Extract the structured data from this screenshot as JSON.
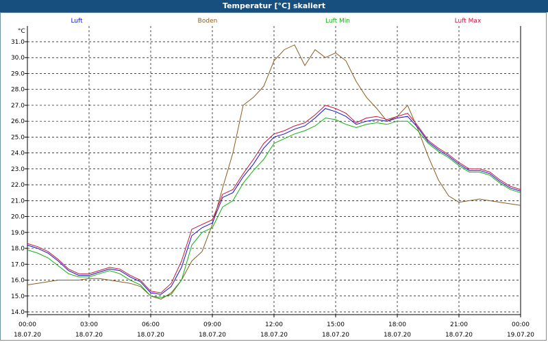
{
  "title": "Temperatur [°C] skaliert",
  "chart_data": {
    "type": "line",
    "unit": "°C",
    "ylim": [
      14.0,
      31.0
    ],
    "yticks": [
      "14.0",
      "15.0",
      "16.0",
      "17.0",
      "18.0",
      "19.0",
      "20.0",
      "21.0",
      "22.0",
      "23.0",
      "24.0",
      "25.0",
      "26.0",
      "27.0",
      "28.0",
      "29.0",
      "30.0",
      "31.0"
    ],
    "xlim_hours": [
      0,
      24
    ],
    "xticks": [
      {
        "time": "00:00",
        "date": "18.07.20"
      },
      {
        "time": "03:00",
        "date": "18.07.20"
      },
      {
        "time": "06:00",
        "date": "18.07.20"
      },
      {
        "time": "09:00",
        "date": "18.07.20"
      },
      {
        "time": "12:00",
        "date": "18.07.20"
      },
      {
        "time": "15:00",
        "date": "18.07.20"
      },
      {
        "time": "18:00",
        "date": "18.07.20"
      },
      {
        "time": "21:00",
        "date": "18.07.20"
      },
      {
        "time": "00:00",
        "date": "19.07.20"
      }
    ],
    "grid": true,
    "legend_position": "top",
    "x_hours": [
      0,
      0.5,
      1,
      1.5,
      2,
      2.5,
      3,
      3.5,
      4,
      4.5,
      5,
      5.5,
      6,
      6.5,
      7,
      7.5,
      8,
      8.5,
      9,
      9.5,
      10,
      10.5,
      11,
      11.5,
      12,
      12.5,
      13,
      13.5,
      14,
      14.5,
      15,
      15.5,
      16,
      16.5,
      17,
      17.5,
      18,
      18.5,
      19,
      19.5,
      20,
      20.5,
      21,
      21.5,
      22,
      22.5,
      23,
      23.5,
      24
    ],
    "series": [
      {
        "name": "Luft",
        "color": "#1010c8",
        "values": [
          18.2,
          18.0,
          17.7,
          17.2,
          16.6,
          16.3,
          16.3,
          16.5,
          16.7,
          16.6,
          16.2,
          15.9,
          15.2,
          15.1,
          15.6,
          16.8,
          18.8,
          19.3,
          19.6,
          21.2,
          21.5,
          22.5,
          23.3,
          24.3,
          25.0,
          25.2,
          25.5,
          25.7,
          26.2,
          26.8,
          26.6,
          26.3,
          25.8,
          26.0,
          26.1,
          26.0,
          26.2,
          26.3,
          25.6,
          24.7,
          24.2,
          23.8,
          23.3,
          22.9,
          22.9,
          22.7,
          22.2,
          21.8,
          21.6
        ]
      },
      {
        "name": "Boden",
        "color": "#8b5a1e",
        "values": [
          15.7,
          15.8,
          15.9,
          16.0,
          16.0,
          16.0,
          16.1,
          16.1,
          16.0,
          15.9,
          15.8,
          15.6,
          15.0,
          14.8,
          15.2,
          16.0,
          17.2,
          17.8,
          19.5,
          21.8,
          24.0,
          27.0,
          27.5,
          28.2,
          29.8,
          30.5,
          30.8,
          29.5,
          30.5,
          30.0,
          30.3,
          29.8,
          28.5,
          27.5,
          26.8,
          26.0,
          26.3,
          27.0,
          25.5,
          23.8,
          22.3,
          21.3,
          20.9,
          21.0,
          21.1,
          21.0,
          20.9,
          20.8,
          20.7
        ]
      },
      {
        "name": "Luft Min",
        "color": "#10b010",
        "values": [
          17.9,
          17.7,
          17.4,
          16.9,
          16.4,
          16.2,
          16.2,
          16.4,
          16.6,
          16.4,
          16.0,
          15.7,
          15.0,
          14.9,
          15.1,
          16.0,
          18.2,
          19.0,
          19.3,
          20.6,
          21.0,
          22.1,
          22.9,
          23.6,
          24.6,
          24.9,
          25.2,
          25.4,
          25.7,
          26.2,
          26.1,
          25.8,
          25.6,
          25.8,
          25.9,
          25.8,
          26.0,
          26.0,
          25.4,
          24.6,
          24.1,
          23.7,
          23.2,
          22.8,
          22.8,
          22.6,
          22.1,
          21.7,
          21.5
        ]
      },
      {
        "name": "Luft Max",
        "color": "#c81040",
        "values": [
          18.3,
          18.1,
          17.8,
          17.3,
          16.7,
          16.4,
          16.4,
          16.6,
          16.8,
          16.7,
          16.3,
          16.0,
          15.3,
          15.2,
          15.8,
          17.2,
          19.2,
          19.5,
          19.8,
          21.4,
          21.7,
          22.7,
          23.6,
          24.6,
          25.2,
          25.4,
          25.7,
          25.9,
          26.4,
          27.0,
          26.8,
          26.5,
          25.9,
          26.2,
          26.3,
          26.1,
          26.3,
          26.5,
          25.7,
          24.8,
          24.3,
          23.9,
          23.4,
          23.0,
          23.0,
          22.8,
          22.3,
          21.9,
          21.7
        ]
      }
    ]
  }
}
